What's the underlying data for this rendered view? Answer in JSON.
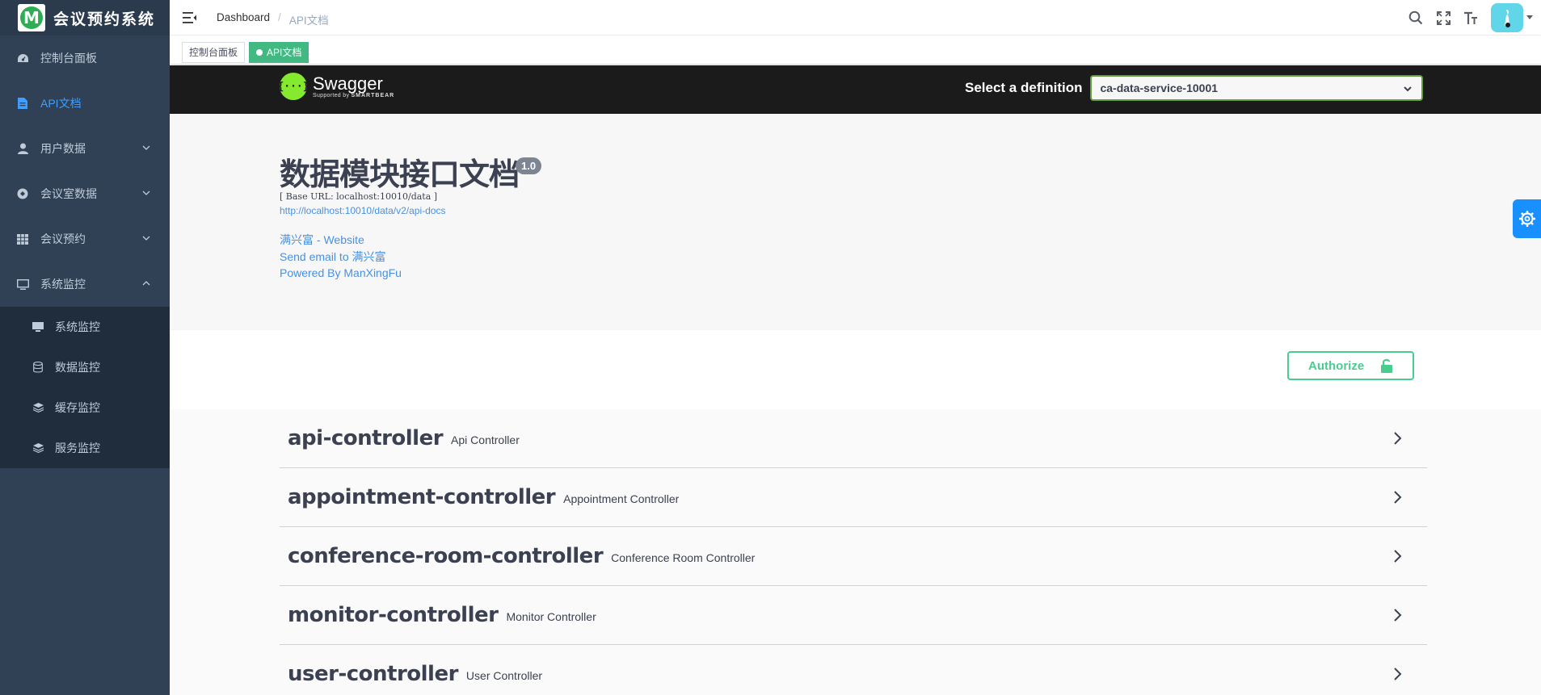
{
  "app": {
    "logo_letter": "M",
    "title": "会议预约系统"
  },
  "sidebar": {
    "items": [
      {
        "label": "控制台面板",
        "icon": "dashboard-icon"
      },
      {
        "label": "API文档",
        "icon": "document-icon",
        "active": true
      },
      {
        "label": "用户数据",
        "icon": "user-icon",
        "expandable": true
      },
      {
        "label": "会议室数据",
        "icon": "room-icon",
        "expandable": true
      },
      {
        "label": "会议预约",
        "icon": "grid-icon",
        "expandable": true
      },
      {
        "label": "系统监控",
        "icon": "monitor-icon",
        "expandable": true,
        "expanded": true
      }
    ],
    "subitems": [
      {
        "label": "系统监控",
        "icon": "monitor-icon"
      },
      {
        "label": "数据监控",
        "icon": "database-icon"
      },
      {
        "label": "缓存监控",
        "icon": "layers-icon"
      },
      {
        "label": "服务监控",
        "icon": "layers-icon"
      }
    ]
  },
  "navbar": {
    "breadcrumb": {
      "home": "Dashboard",
      "separator": "/",
      "current": "API文档"
    },
    "icons": [
      "search-icon",
      "fullscreen-icon",
      "font-size-icon"
    ]
  },
  "tags": {
    "items": [
      "控制台面板",
      "API文档"
    ],
    "active_index": 1
  },
  "swagger": {
    "logo": {
      "glyph": "{···}",
      "name": "Swagger",
      "sub_prefix": "Supported by",
      "sub_brand": "SMARTBEAR"
    },
    "select_label": "Select a definition",
    "select_value": "ca-data-service-10001",
    "title": "数据模块接口文档",
    "version": "1.0",
    "base_url": "[ Base URL: localhost:10010/data ]",
    "api_docs_url": "http://localhost:10010/data/v2/api-docs",
    "website": "满兴富 - Website",
    "email": "Send email to 满兴富",
    "powered_by": "Powered By ManXingFu",
    "authorize_label": "Authorize",
    "operations": [
      {
        "name": "api-controller",
        "desc": "Api Controller"
      },
      {
        "name": "appointment-controller",
        "desc": "Appointment Controller"
      },
      {
        "name": "conference-room-controller",
        "desc": "Conference Room Controller"
      },
      {
        "name": "monitor-controller",
        "desc": "Monitor Controller"
      },
      {
        "name": "user-controller",
        "desc": "User Controller"
      }
    ]
  },
  "colors": {
    "sidebar_bg": "#304156",
    "active_menu": "#409eff",
    "tag_active": "#42b983",
    "swagger_green": "#49cc90",
    "link": "#4990e2"
  }
}
